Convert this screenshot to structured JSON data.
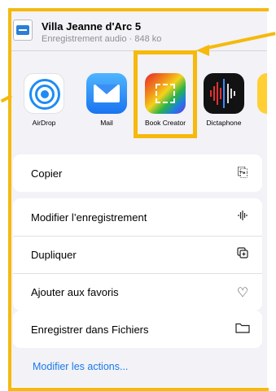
{
  "file": {
    "name": "Villa Jeanne d'Arc 5",
    "meta": "Enregistrement audio · 848 ko"
  },
  "apps": [
    {
      "label": "AirDrop",
      "icon": "airdrop-icon"
    },
    {
      "label": "Mail",
      "icon": "mail-icon"
    },
    {
      "label": "Book Creator",
      "icon": "book-creator-icon"
    },
    {
      "label": "Dictaphone",
      "icon": "dictaphone-icon"
    }
  ],
  "actions": {
    "copy": {
      "label": "Copier",
      "icon": "copy-icon"
    },
    "edit": {
      "label": "Modifier l’enregistrement",
      "icon": "waveform-icon"
    },
    "duplicate": {
      "label": "Dupliquer",
      "icon": "duplicate-icon"
    },
    "favorite": {
      "label": "Ajouter aux favoris",
      "icon": "heart-icon"
    },
    "save_files": {
      "label": "Enregistrer dans Fichiers",
      "icon": "folder-icon"
    },
    "edit_actions": "Modifier les actions..."
  },
  "annotation_color": "#f6b90c",
  "link_color": "#1a7ae8"
}
